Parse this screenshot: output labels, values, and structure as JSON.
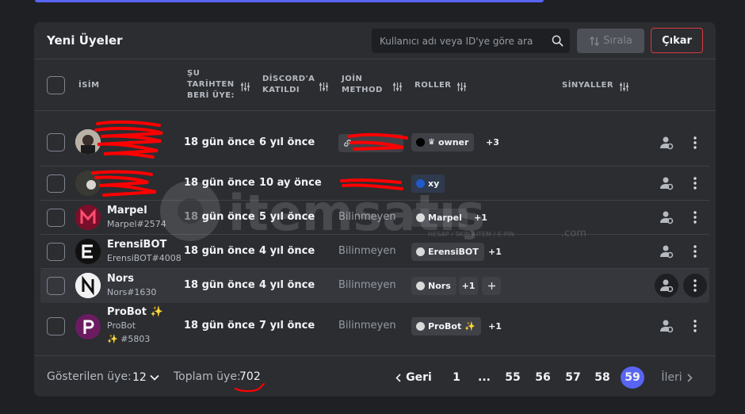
{
  "page": {
    "title": "Yeni Üyeler",
    "search_placeholder": "Kullanıcı adı veya ID'ye göre ara",
    "sort_label": "Sırala",
    "exit_label": "Çıkar"
  },
  "columns": {
    "name": "İSİM",
    "member_since": [
      "ŞU",
      "TARİHTEN",
      "BERİ ÜYE:"
    ],
    "discord_joined": [
      "DİSCORD'A",
      "KATILDI"
    ],
    "join_method": [
      "JOİN",
      "METHOD"
    ],
    "roles": "ROLLER",
    "signals": "SİNYALLER"
  },
  "rows": [
    {
      "name": "",
      "tag": "",
      "member_since": "18 gün önce",
      "discord_joined": "6 yıl önce",
      "join_method": "",
      "roles": [
        {
          "label": "owner",
          "color": "#000000"
        }
      ],
      "more": "+3",
      "avatar": "photo"
    },
    {
      "name": "",
      "tag": "",
      "member_since": "18 gün önce",
      "discord_joined": "10 ay önce",
      "join_method": "",
      "roles": [
        {
          "label": "xy",
          "color": "#1f5ac8"
        }
      ],
      "more": "",
      "avatar": "photo2"
    },
    {
      "name": "Marpel",
      "tag": "Marpel#2574",
      "member_since": "18 gün önce",
      "discord_joined": "5 yıl önce",
      "join_method": "Bilinmeyen",
      "roles": [
        {
          "label": "Marpel",
          "color": "#d9d9d9"
        }
      ],
      "more": "+1",
      "avatar": "marpel"
    },
    {
      "name": "ErensiBOT",
      "tag": "ErensiBOT#4008",
      "member_since": "18 gün önce",
      "discord_joined": "4 yıl önce",
      "join_method": "Bilinmeyen",
      "roles": [
        {
          "label": "ErensiBOT",
          "color": "#d9d9d9"
        }
      ],
      "more": "+1",
      "avatar": "erensi"
    },
    {
      "name": "Nors",
      "tag": "Nors#1630",
      "member_since": "18 gün önce",
      "discord_joined": "4 yıl önce",
      "join_method": "Bilinmeyen",
      "roles": [
        {
          "label": "Nors",
          "color": "#d9d9d9"
        }
      ],
      "more": "+1",
      "avatar": "nors"
    },
    {
      "name": "ProBot ✨",
      "tag": "ProBot",
      "tag2": "✨ #5803",
      "member_since": "18 gün önce",
      "discord_joined": "7 yıl önce",
      "join_method": "Bilinmeyen",
      "roles": [
        {
          "label": "ProBot ✨",
          "color": "#d9d9d9"
        }
      ],
      "more": "+1",
      "avatar": "probot"
    }
  ],
  "footer": {
    "shown_label": "Gösterilen üye:",
    "page_size": "12",
    "total_label": "Toplam üye:",
    "total": "702",
    "prev": "Geri",
    "next": "İleri",
    "pages": [
      "1",
      "...",
      "55",
      "56",
      "57",
      "58",
      "59"
    ],
    "current_page": "59"
  },
  "watermark": "itemsatış",
  "watermark_tagline": "HESAP / SKIN / ITEM / E-PIN",
  "watermark_domain": ".com",
  "colors": {
    "accent": "#5865f2",
    "danger": "#da373c",
    "scribble": "#ff0000"
  }
}
